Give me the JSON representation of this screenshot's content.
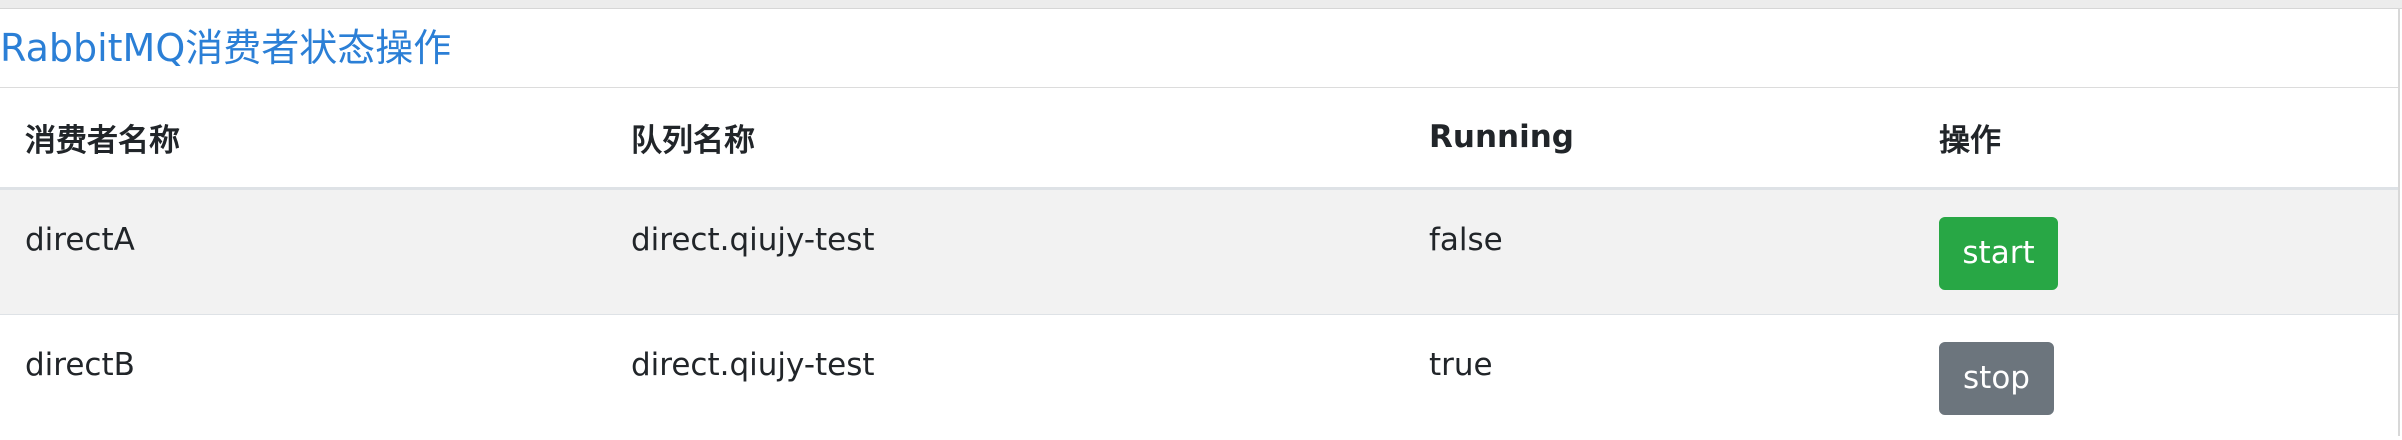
{
  "page": {
    "title": "RabbitMQ消费者状态操作"
  },
  "table": {
    "headers": [
      "消费者名称",
      "队列名称",
      "Running",
      "操作"
    ],
    "rows": [
      {
        "consumer_name": "directA",
        "queue_name": "direct.qiujy-test",
        "running": "false",
        "action_label": "start",
        "action_color": "#28a745"
      },
      {
        "consumer_name": "directB",
        "queue_name": "direct.qiujy-test",
        "running": "true",
        "action_label": "stop",
        "action_color": "#6c757d"
      }
    ]
  },
  "colors": {
    "title": "#2b7fd6",
    "success": "#28a745",
    "secondary": "#6c757d",
    "striped_row": "#f2f2f2"
  }
}
